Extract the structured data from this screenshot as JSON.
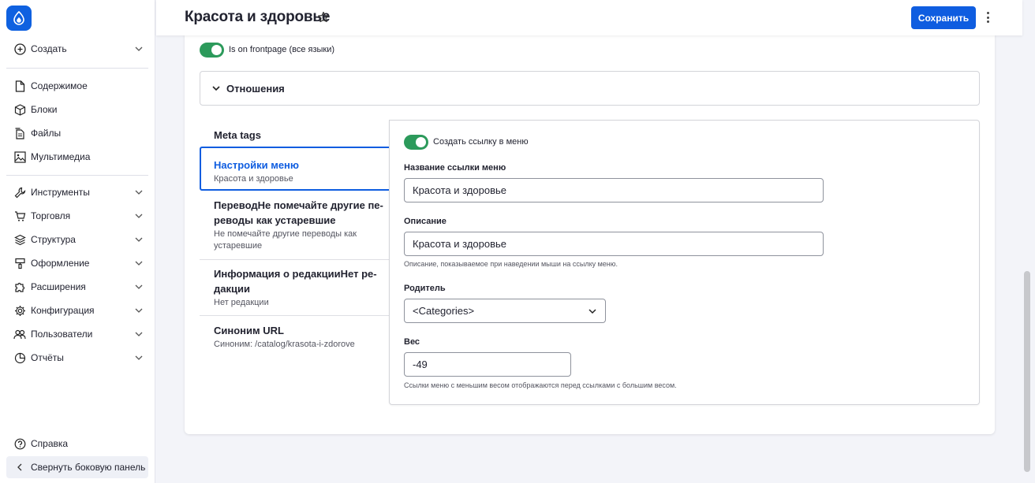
{
  "header": {
    "title": "Красота и здоровье",
    "save_label": "Сохранить"
  },
  "sidebar": {
    "create_label": "Создать",
    "content_items": [
      {
        "label": "Содержимое",
        "icon": "file-icon"
      },
      {
        "label": "Блоки",
        "icon": "cube-icon"
      },
      {
        "label": "Файлы",
        "icon": "files-icon"
      },
      {
        "label": "Мультимедиа",
        "icon": "image-icon"
      }
    ],
    "admin_items": [
      {
        "label": "Инструменты",
        "icon": "wrench-icon"
      },
      {
        "label": "Торговля",
        "icon": "cart-icon"
      },
      {
        "label": "Структура",
        "icon": "layers-icon"
      },
      {
        "label": "Оформление",
        "icon": "brush-icon"
      },
      {
        "label": "Расширения",
        "icon": "puzzle-icon"
      },
      {
        "label": "Конфигурация",
        "icon": "gear-icon"
      },
      {
        "label": "Пользователи",
        "icon": "users-icon"
      },
      {
        "label": "Отчёты",
        "icon": "chart-icon"
      }
    ],
    "help_label": "Справка",
    "collapse_label": "Свернуть боковую панель"
  },
  "frontpage_toggle": {
    "label": "Is on frontpage (все языки)",
    "checked": true
  },
  "relations": {
    "label": "Отношения"
  },
  "tabs": [
    {
      "title": "Meta tags",
      "summary": ""
    },
    {
      "title": "Настройки меню",
      "summary": "Красота и здоровье"
    },
    {
      "title_line1": "ПереводНе помечайте другие пе-",
      "title_line2": "реводы как устаревшие",
      "summary_line1": "Не помечайте другие переводы как",
      "summary_line2": "устаревшие"
    },
    {
      "title_line1": "Информация о редакцииНет ре-",
      "title_line2": "дакции",
      "summary": "Нет редакции"
    },
    {
      "title": "Синоним URL",
      "summary": "Синоним: /catalog/krasota-i-zdorove"
    }
  ],
  "menu_settings": {
    "create_link_label": "Создать ссылку в меню",
    "create_link_checked": true,
    "link_title_label": "Название ссылки меню",
    "link_title_value": "Красота и здоровье",
    "description_label": "Описание",
    "description_value": "Красота и здоровье",
    "description_help": "Описание, показываемое при наведении мыши на ссылку меню.",
    "parent_label": "Родитель",
    "parent_value": "<Categories>",
    "weight_label": "Вес",
    "weight_value": "-49",
    "weight_help": "Ссылки меню с меньшим весом отображаются перед ссылками с большим весом."
  },
  "colors": {
    "accent": "#0f5de0",
    "toggle_on": "#2c9a5b"
  }
}
